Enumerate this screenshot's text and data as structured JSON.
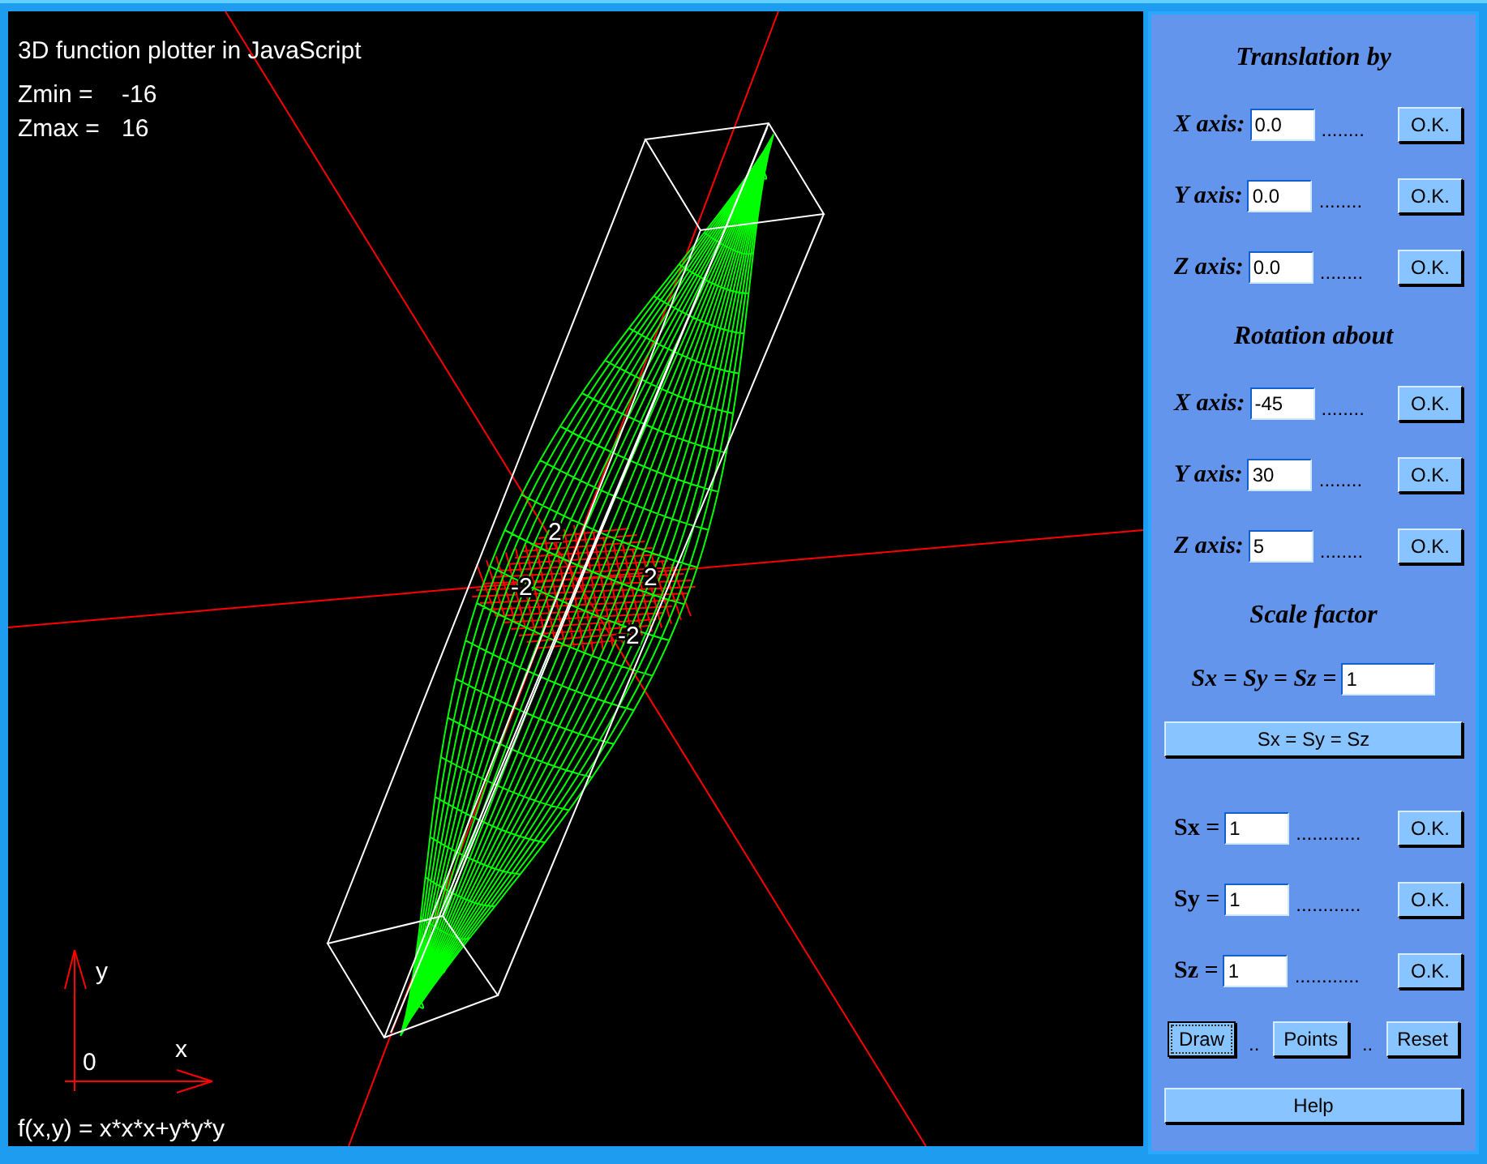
{
  "plot": {
    "title": "3D function plotter in JavaScript",
    "zmin_label": "Zmin =",
    "zmin": "-16",
    "zmax_label": "Zmax =",
    "zmax": "16",
    "function": "f(x,y) = x*x*x+y*y*y",
    "axis_labels": {
      "y": "y",
      "x": "x",
      "origin": "0"
    },
    "tick_labels": [
      "2",
      "-2",
      "2",
      "-2"
    ]
  },
  "panel": {
    "sections": [
      {
        "kind": "axis",
        "heading": "Translation by",
        "rows": [
          {
            "label": "X axis:",
            "value": "0.0",
            "dots": "........",
            "button": "O.K."
          },
          {
            "label": "Y axis:",
            "value": "0.0",
            "dots": "........",
            "button": "O.K."
          },
          {
            "label": "Z axis:",
            "value": "0.0",
            "dots": "........",
            "button": "O.K."
          }
        ]
      },
      {
        "kind": "axis",
        "heading": "Rotation about",
        "rows": [
          {
            "label": "X axis:",
            "value": "-45",
            "dots": "........",
            "button": "O.K."
          },
          {
            "label": "Y axis:",
            "value": "30",
            "dots": "........",
            "button": "O.K."
          },
          {
            "label": "Z axis:",
            "value": "5",
            "dots": "........",
            "button": "O.K."
          }
        ]
      },
      {
        "kind": "scale",
        "heading": "Scale factor",
        "uniform_label": "Sx = Sy = Sz =",
        "uniform_value": "1",
        "uniform_button": "Sx = Sy = Sz",
        "rows": [
          {
            "label": "Sx =",
            "value": "1",
            "dots": "............",
            "button": "O.K."
          },
          {
            "label": "Sy =",
            "value": "1",
            "dots": "............",
            "button": "O.K."
          },
          {
            "label": "Sz =",
            "value": "1",
            "dots": "............",
            "button": "O.K."
          }
        ]
      }
    ],
    "actions": [
      {
        "label": "Draw",
        "focused": true
      },
      {
        "label": "Points",
        "focused": false
      },
      {
        "label": "Reset",
        "focused": false
      }
    ],
    "separators": [
      "..",
      ".."
    ],
    "help": "Help"
  }
}
